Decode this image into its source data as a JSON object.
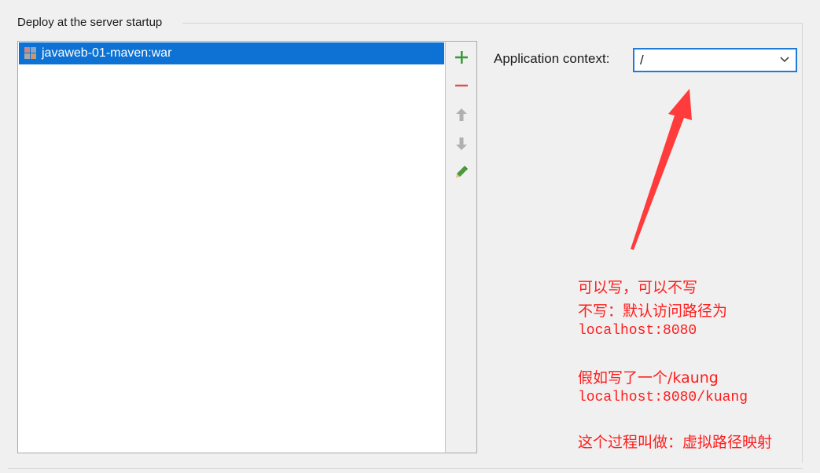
{
  "group": {
    "title": "Deploy at the server startup"
  },
  "list": {
    "items": [
      {
        "label": "javaweb-01-maven:war",
        "icon": "war-artifact-icon",
        "selected": true
      }
    ]
  },
  "toolbar": {
    "buttons": [
      {
        "name": "add",
        "icon": "plus-icon",
        "color": "#3b9a3b"
      },
      {
        "name": "remove",
        "icon": "minus-icon",
        "color": "#d9534f"
      },
      {
        "name": "move-up",
        "icon": "arrow-up-icon",
        "color": "#b0b0b0"
      },
      {
        "name": "move-down",
        "icon": "arrow-down-icon",
        "color": "#b0b0b0"
      },
      {
        "name": "edit",
        "icon": "pencil-icon",
        "color": "#4a9a3a"
      }
    ]
  },
  "context": {
    "label": "Application context:",
    "value": "/"
  },
  "annotation": {
    "color": "#ff1c1c",
    "lines": [
      "可以写，可以不写",
      "不写：默认访问路径为",
      "localhost:8080",
      "假如写了一个/kaung",
      "localhost:8080/kuang",
      "这个过程叫做：虚拟路径映射"
    ]
  }
}
